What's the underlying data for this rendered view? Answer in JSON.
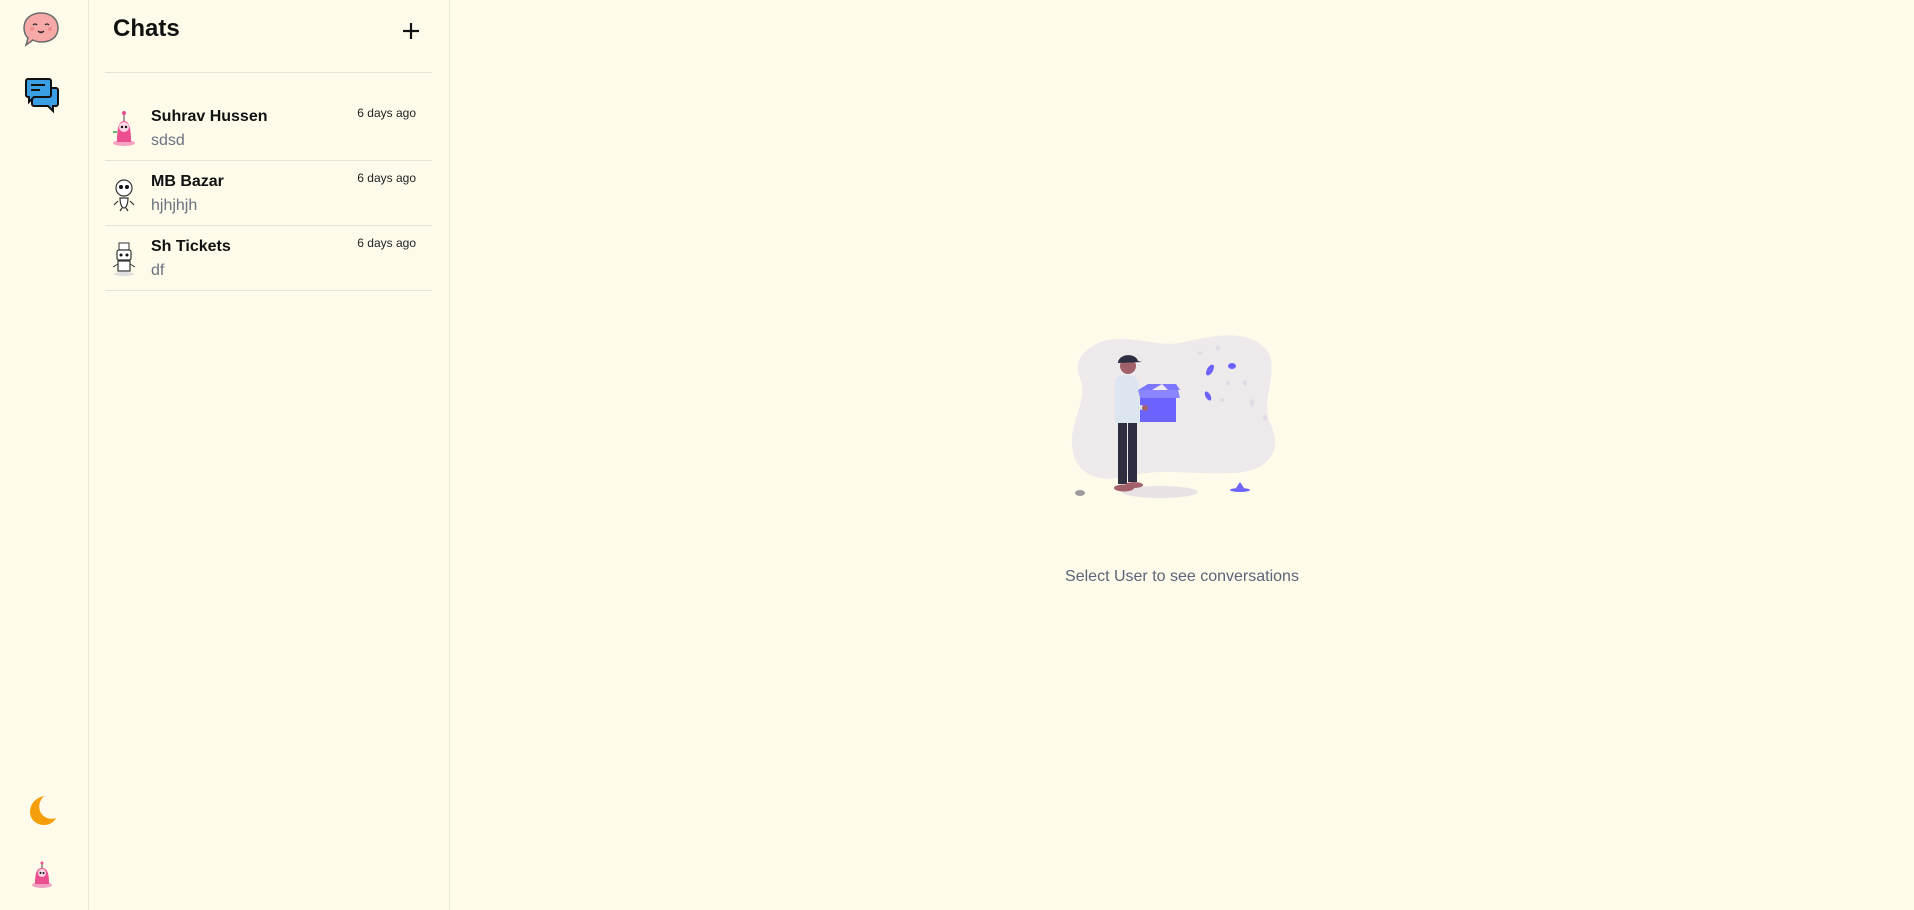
{
  "sidebar": {
    "logo_icon": "chat-bubble-face-icon",
    "chats_icon": "chat-bubbles-icon",
    "theme_icon": "moon-icon",
    "profile_avatar": "pink-robot-avatar"
  },
  "chats_panel": {
    "title": "Chats",
    "new_chat_icon": "plus-icon",
    "items": [
      {
        "name": "Suhrav Hussen",
        "preview": "sdsd",
        "time": "6 days ago",
        "avatar": "pink-robot-avatar"
      },
      {
        "name": "MB Bazar",
        "preview": "hjhjhjh",
        "time": "6 days ago",
        "avatar": "sketch-robot-avatar"
      },
      {
        "name": "Sh Tickets",
        "preview": "df",
        "time": "6 days ago",
        "avatar": "sketch-robot-avatar"
      }
    ]
  },
  "main": {
    "empty_message": "Select User to see conversations",
    "illustration": "person-holding-box-illustration"
  },
  "colors": {
    "background": "#fefbeb",
    "accent_blue": "#3b9fe6",
    "moon": "#f59e0b",
    "pink": "#ec4f8f",
    "illustration_purple": "#6c63ff"
  }
}
